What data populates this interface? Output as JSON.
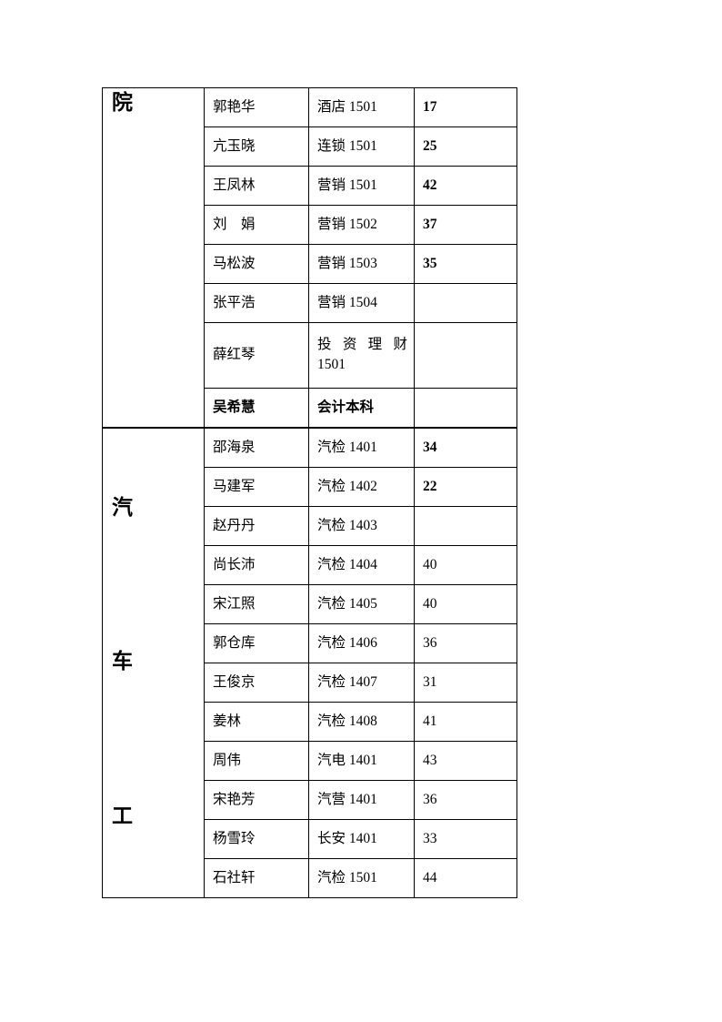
{
  "document": {
    "type": "roster-table",
    "columns": [
      "group",
      "name",
      "class",
      "count"
    ],
    "groups": [
      {
        "label": "院",
        "label_chars": [
          "院"
        ],
        "label_layout": "top",
        "rows": [
          {
            "name": "郭艳华",
            "class": "酒店 1501",
            "count": "17",
            "bold_name": false,
            "bold_class": false,
            "bold_count": true,
            "justify_class": false,
            "tall": false
          },
          {
            "name": "亢玉晓",
            "class": "连锁 1501",
            "count": "25",
            "bold_name": false,
            "bold_class": false,
            "bold_count": true,
            "justify_class": false,
            "tall": false
          },
          {
            "name": "王凤林",
            "class": "营销 1501",
            "count": "42",
            "bold_name": false,
            "bold_class": false,
            "bold_count": true,
            "justify_class": false,
            "tall": false
          },
          {
            "name": "刘　娟",
            "class": "营销 1502",
            "count": "37",
            "bold_name": false,
            "bold_class": false,
            "bold_count": true,
            "justify_class": false,
            "tall": false
          },
          {
            "name": "马松波",
            "class": "营销 1503",
            "count": "35",
            "bold_name": false,
            "bold_class": false,
            "bold_count": true,
            "justify_class": false,
            "tall": false
          },
          {
            "name": "张平浩",
            "class": "营销 1504",
            "count": "",
            "bold_name": false,
            "bold_class": false,
            "bold_count": false,
            "justify_class": false,
            "tall": false
          },
          {
            "name": "薛红琴",
            "class": "投资理财\n1501",
            "count": "",
            "bold_name": false,
            "bold_class": false,
            "bold_count": false,
            "justify_class": true,
            "tall": true
          },
          {
            "name": "吴希慧",
            "class": "会计本科",
            "count": "",
            "bold_name": true,
            "bold_class": true,
            "bold_count": false,
            "justify_class": false,
            "tall": false
          }
        ]
      },
      {
        "label": "汽车工",
        "label_chars": [
          "汽",
          "车",
          "工"
        ],
        "label_layout": "spread",
        "rows": [
          {
            "name": "邵海泉",
            "class": "汽检 1401",
            "count": "34",
            "bold_name": false,
            "bold_class": false,
            "bold_count": true,
            "justify_class": false,
            "tall": false
          },
          {
            "name": "马建军",
            "class": "汽检 1402",
            "count": "22",
            "bold_name": false,
            "bold_class": false,
            "bold_count": true,
            "justify_class": false,
            "tall": false
          },
          {
            "name": "赵丹丹",
            "class": "汽检 1403",
            "count": "",
            "bold_name": false,
            "bold_class": false,
            "bold_count": false,
            "justify_class": false,
            "tall": false
          },
          {
            "name": "尚长沛",
            "class": "汽检 1404",
            "count": "40",
            "bold_name": false,
            "bold_class": false,
            "bold_count": false,
            "justify_class": false,
            "tall": false
          },
          {
            "name": "宋江照",
            "class": "汽检 1405",
            "count": "40",
            "bold_name": false,
            "bold_class": false,
            "bold_count": false,
            "justify_class": false,
            "tall": false
          },
          {
            "name": "郭仓库",
            "class": "汽检 1406",
            "count": "36",
            "bold_name": false,
            "bold_class": false,
            "bold_count": false,
            "justify_class": false,
            "tall": false
          },
          {
            "name": "王俊京",
            "class": "汽检 1407",
            "count": "31",
            "bold_name": false,
            "bold_class": false,
            "bold_count": false,
            "justify_class": false,
            "tall": false
          },
          {
            "name": "姜林",
            "class": "汽检 1408",
            "count": "41",
            "bold_name": false,
            "bold_class": false,
            "bold_count": false,
            "justify_class": false,
            "tall": false
          },
          {
            "name": "周伟",
            "class": "汽电 1401",
            "count": "43",
            "bold_name": false,
            "bold_class": false,
            "bold_count": false,
            "justify_class": false,
            "tall": false
          },
          {
            "name": "宋艳芳",
            "class": "汽营 1401",
            "count": "36",
            "bold_name": false,
            "bold_class": false,
            "bold_count": false,
            "justify_class": false,
            "tall": false
          },
          {
            "name": "杨雪玲",
            "class": "长安 1401",
            "count": "33",
            "bold_name": false,
            "bold_class": false,
            "bold_count": false,
            "justify_class": false,
            "tall": false
          },
          {
            "name": "石社轩",
            "class": "汽检 1501",
            "count": "44",
            "bold_name": false,
            "bold_class": false,
            "bold_count": false,
            "justify_class": false,
            "tall": false
          }
        ]
      }
    ]
  }
}
